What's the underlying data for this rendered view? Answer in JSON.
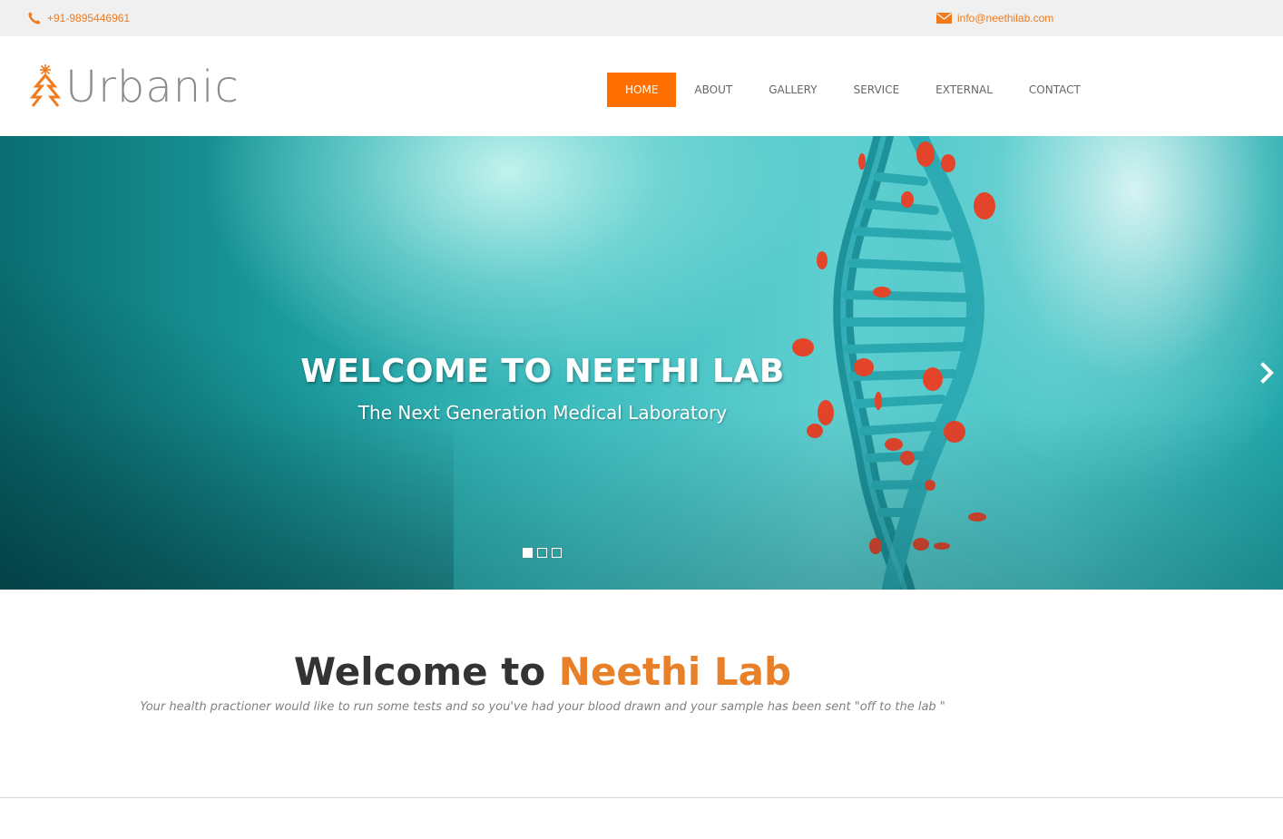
{
  "topbar": {
    "phone": "+91-9895446961",
    "email": "info@neethilab.com",
    "phone_icon": "phone-icon",
    "email_icon": "envelope-icon"
  },
  "logo": {
    "text": "Urbanic",
    "icon": "tree-logo-icon"
  },
  "nav": {
    "items": [
      {
        "label": "HOME"
      },
      {
        "label": "ABOUT"
      },
      {
        "label": "GALLERY"
      },
      {
        "label": "SERVICE"
      },
      {
        "label": "EXTERNAL"
      },
      {
        "label": "CONTACT"
      }
    ],
    "active": "HOME"
  },
  "hero": {
    "title": "WELCOME TO NEETHI LAB",
    "subtitle": "The Next Generation Medical Laboratory",
    "next_icon": "chevron-right-icon",
    "slides": 3,
    "current_slide": 1
  },
  "intro": {
    "heading_part1": "Welcome to ",
    "heading_part2": "Neethi Lab",
    "tagline": "Your health practioner would like to run some tests and so you've had your blood drawn and your sample has been sent \"off to the lab \""
  },
  "colors": {
    "accent": "#ff6f00",
    "topbar_bg": "#f0f0f0",
    "hero_teal": "#3ebdbf",
    "highlight": "#e8802a"
  }
}
